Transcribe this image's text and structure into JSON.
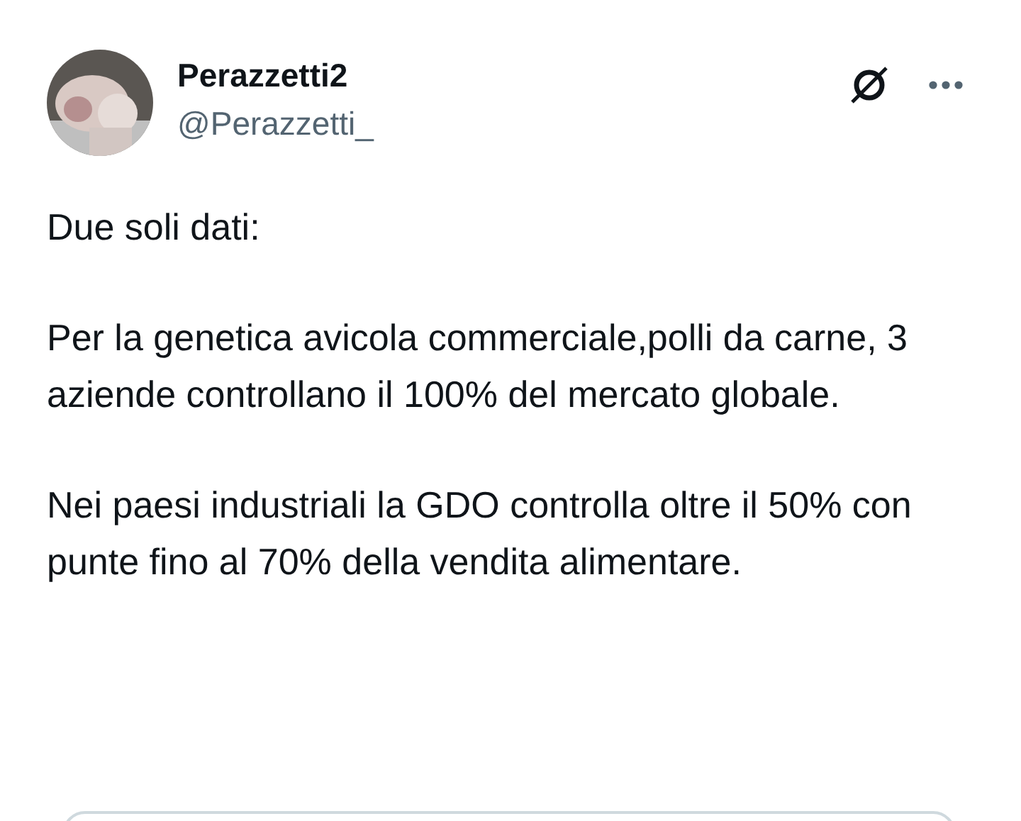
{
  "author": {
    "name": "Perazzetti2",
    "handle": "@Perazzetti_"
  },
  "paragraphs": [
    "Due soli dati:",
    "Per la genetica avicola commerciale,polli da carne, 3 aziende controllano il 100% del mercato globale.",
    "Nei paesi industriali la GDO controlla oltre il 50% con punte fino al 70% della vendita alimentare."
  ]
}
